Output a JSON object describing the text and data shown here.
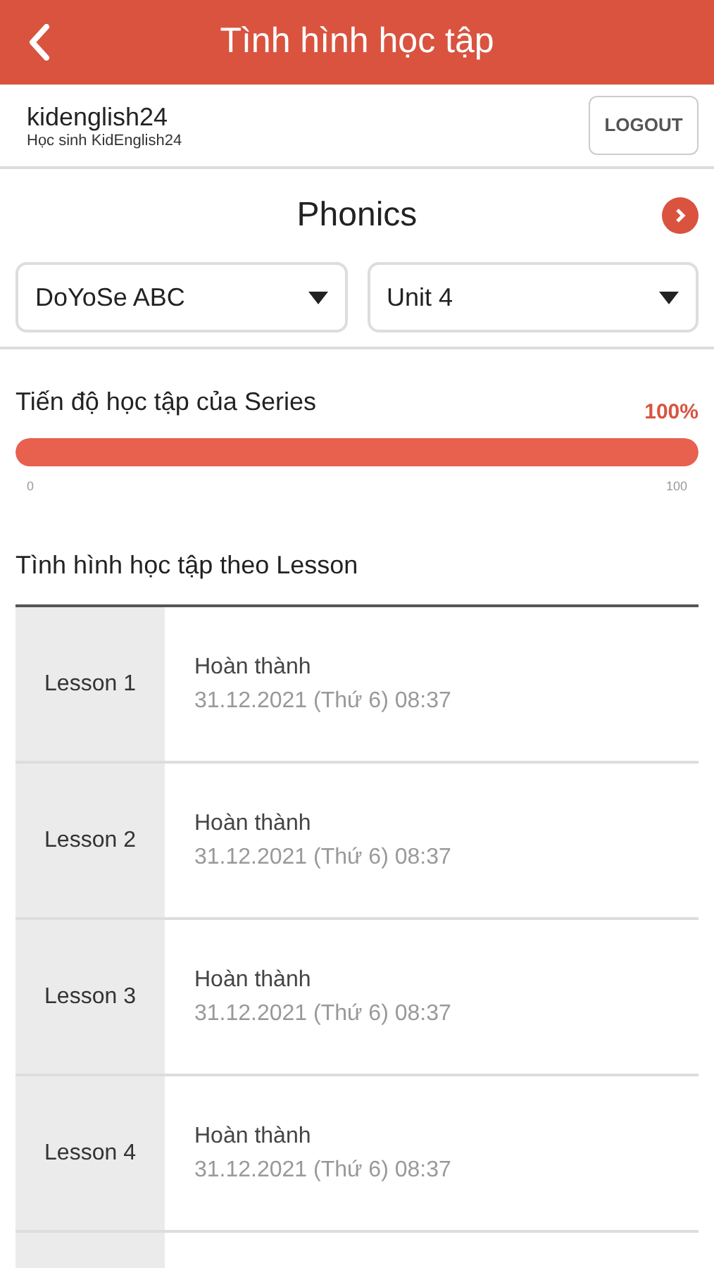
{
  "header": {
    "title": "Tình hình học tập"
  },
  "user": {
    "username": "kidenglish24",
    "role": "Học sinh KidEnglish24",
    "logout": "LOGOUT"
  },
  "course": {
    "title": "Phonics",
    "series": "DoYoSe ABC",
    "unit": "Unit 4"
  },
  "progress": {
    "title": "Tiến độ học tập của Series",
    "reading": "100%",
    "level": 1,
    "min": "0",
    "max": "100"
  },
  "lessons_title": "Tình hình học tập theo Lesson",
  "lessons": [
    {
      "name": "Lesson 1",
      "status": "Hoàn thành",
      "date": "31.12.2021 (Thứ 6) 08:37"
    },
    {
      "name": "Lesson 2",
      "status": "Hoàn thành",
      "date": "31.12.2021 (Thứ 6) 08:37"
    },
    {
      "name": "Lesson 3",
      "status": "Hoàn thành",
      "date": "31.12.2021 (Thứ 6) 08:37"
    },
    {
      "name": "Lesson 4",
      "status": "Hoàn thành",
      "date": "31.12.2021 (Thứ 6) 08:37"
    }
  ]
}
